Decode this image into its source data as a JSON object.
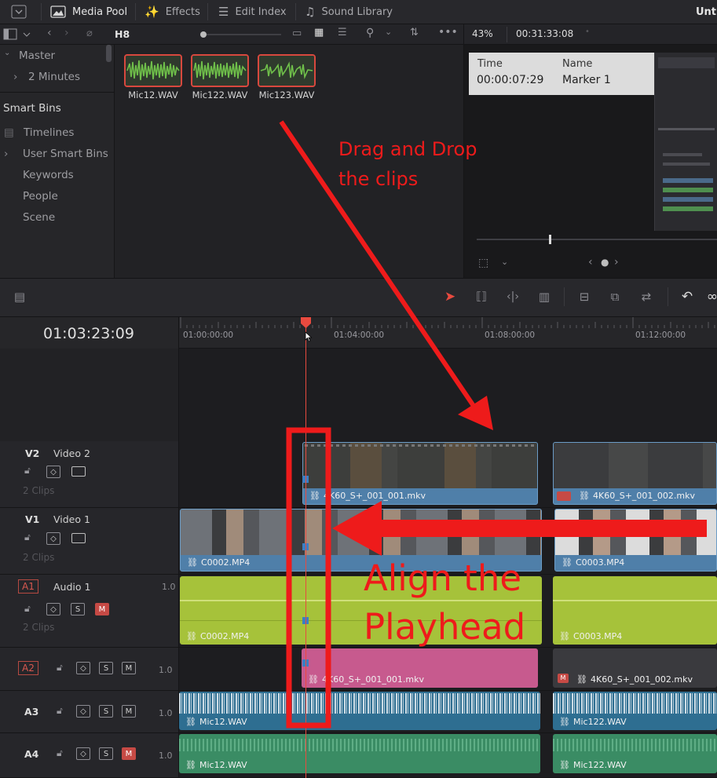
{
  "topbar": {
    "media_pool": "Media Pool",
    "effects": "Effects",
    "edit_index": "Edit Index",
    "sound_library": "Sound Library",
    "project_title": "Unt"
  },
  "pool_toolbar": {
    "bin_name": "H8"
  },
  "sidebar": {
    "master": "Master",
    "two_minutes": "2 Minutes",
    "smart_bins": "Smart Bins",
    "timelines": "Timelines",
    "user_smart_bins": "User Smart Bins",
    "keywords": "Keywords",
    "people": "People",
    "scene": "Scene"
  },
  "pool_clips": [
    {
      "name": "Mic12.WAV"
    },
    {
      "name": "Mic122.WAV"
    },
    {
      "name": "Mic123.WAV"
    }
  ],
  "viewer": {
    "zoom": "43%",
    "timecode": "00:31:33:08",
    "marker_time_header": "Time",
    "marker_name_header": "Name",
    "marker_time": "00:00:07:29",
    "marker_name": "Marker 1"
  },
  "timeline": {
    "current_timecode": "01:03:23:09",
    "ruler_labels": [
      "01:00:00:00",
      "01:04:00:00",
      "01:08:00:00",
      "01:12:00:00"
    ]
  },
  "tracks": {
    "v2": {
      "id": "V2",
      "name": "Video 2",
      "clips_count": "2 Clips"
    },
    "v1": {
      "id": "V1",
      "name": "Video 1",
      "clips_count": "2 Clips"
    },
    "a1": {
      "id": "A1",
      "name": "Audio 1",
      "level": "1.0",
      "clips_count": "2 Clips",
      "solo": "S",
      "mute": "M"
    },
    "a2": {
      "id": "A2",
      "level": "1.0",
      "solo": "S",
      "mute": "M"
    },
    "a3": {
      "id": "A3",
      "level": "1.0",
      "solo": "S",
      "mute": "M"
    },
    "a4": {
      "id": "A4",
      "level": "1.0",
      "solo": "S",
      "mute": "M"
    }
  },
  "clips": {
    "v2_1": "4K60_S+_001_001.mkv",
    "v2_2": "4K60_S+_001_002.mkv",
    "v1_1": "C0002.MP4",
    "v1_2": "C0003.MP4",
    "a1_1": "C0002.MP4",
    "a1_2": "C0003.MP4",
    "a2_1": "4K60_S+_001_001.mkv",
    "a2_2": "4K60_S+_001_002.mkv",
    "a3_1": "Mic12.WAV",
    "a3_2": "Mic122.WAV",
    "a4_1": "Mic12.WAV",
    "a4_2": "Mic122.WAV"
  },
  "annotations": {
    "drag_line1": "Drag and Drop",
    "drag_line2": "the clips",
    "align_line1": "Align the",
    "align_line2": "Playhead"
  },
  "colors": {
    "playhead": "#e84a3f",
    "video_clip": "#4f7fa9",
    "audio_green": "#a6c23a",
    "audio_pink": "#c75a8e",
    "audio_blue": "#2e6e91",
    "audio_teal": "#3a8c64",
    "annotation": "#ee1b1b"
  }
}
